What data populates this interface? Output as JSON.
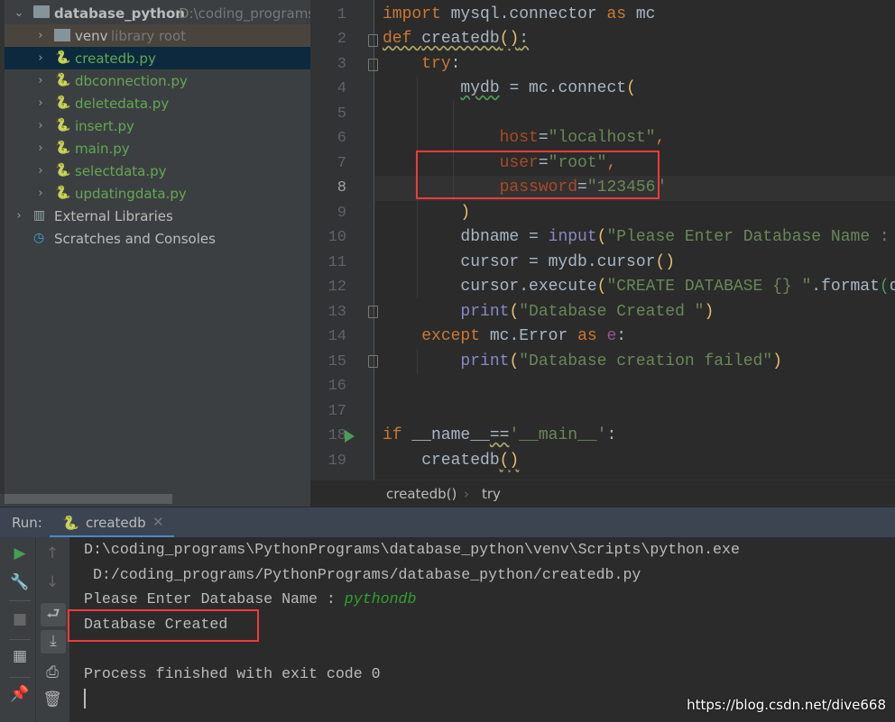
{
  "project": {
    "root": {
      "name": "database_python",
      "path": "D:\\coding_programs"
    },
    "venv": {
      "name": "venv",
      "note": "library root"
    },
    "files": [
      "createdb.py",
      "dbconnection.py",
      "deletedata.py",
      "insert.py",
      "main.py",
      "selectdata.py",
      "updatingdata.py"
    ],
    "selected_file": "createdb.py",
    "external_libraries": "External Libraries",
    "scratches": "Scratches and Consoles"
  },
  "editor": {
    "current_line": 8,
    "lines": [
      [
        [
          "k",
          "import "
        ],
        [
          "",
          "mysql.connector "
        ],
        [
          "k",
          "as "
        ],
        [
          "",
          "mc"
        ]
      ],
      [
        [
          "kw",
          "def "
        ],
        [
          "fw",
          "createdb"
        ],
        [
          "brw",
          "()"
        ],
        [
          "w",
          ":"
        ]
      ],
      [
        [
          "",
          "    "
        ],
        [
          "k",
          "try"
        ],
        [
          "",
          ":"
        ]
      ],
      [
        [
          "",
          "        "
        ],
        [
          "vw",
          "mydb"
        ],
        [
          "",
          " = mc.connect"
        ],
        [
          "br",
          "("
        ]
      ],
      [],
      [
        [
          "",
          "            "
        ],
        [
          "p",
          "host"
        ],
        [
          "",
          "="
        ],
        [
          "s",
          "\"localhost\""
        ],
        [
          "k",
          ","
        ]
      ],
      [
        [
          "",
          "            "
        ],
        [
          "p",
          "user"
        ],
        [
          "",
          "="
        ],
        [
          "s",
          "\"root\""
        ],
        [
          "k",
          ","
        ]
      ],
      [
        [
          "",
          "            "
        ],
        [
          "p",
          "password"
        ],
        [
          "",
          "="
        ],
        [
          "s",
          "\"123456\""
        ]
      ],
      [
        [
          "",
          "        "
        ],
        [
          "br",
          ")"
        ]
      ],
      [
        [
          "",
          "        dbname = "
        ],
        [
          "b",
          "input"
        ],
        [
          "br",
          "("
        ],
        [
          "s",
          "\"Please Enter Database Name : \""
        ],
        [
          "br",
          ")"
        ]
      ],
      [
        [
          "",
          "        cursor = mydb.cursor"
        ],
        [
          "br",
          "()"
        ]
      ],
      [
        [
          "",
          "        cursor.execute"
        ],
        [
          "br",
          "("
        ],
        [
          "s",
          "\"CREATE DATABASE {} \""
        ],
        [
          "",
          ".format"
        ],
        [
          "g",
          "("
        ],
        [
          "",
          "dbname"
        ]
      ],
      [
        [
          "",
          "        "
        ],
        [
          "b",
          "print"
        ],
        [
          "br",
          "("
        ],
        [
          "s",
          "\"Database Created \""
        ],
        [
          "br",
          ")"
        ]
      ],
      [
        [
          "",
          "    "
        ],
        [
          "k",
          "except "
        ],
        [
          "",
          "mc.Error "
        ],
        [
          "k",
          "as "
        ],
        [
          "e",
          "e"
        ],
        [
          "",
          ":"
        ]
      ],
      [
        [
          "",
          "        "
        ],
        [
          "b",
          "print"
        ],
        [
          "br",
          "("
        ],
        [
          "s",
          "\"Database creation failed\""
        ],
        [
          "br",
          ")"
        ]
      ],
      [],
      [],
      [
        [
          "k",
          "if "
        ],
        [
          "",
          "__name__"
        ],
        [
          "w",
          "=="
        ],
        [
          "s",
          "'__main__'"
        ],
        [
          "",
          ":"
        ]
      ],
      [
        [
          "",
          "    createdb"
        ],
        [
          "brw",
          "()"
        ]
      ]
    ]
  },
  "breadcrumb": [
    "createdb()",
    "try"
  ],
  "run": {
    "label": "Run:",
    "tab": "createdb",
    "console": {
      "line1": "D:\\coding_programs\\PythonPrograms\\database_python\\venv\\Scripts\\python.exe",
      "line2": " D:/coding_programs/PythonPrograms/database_python/createdb.py",
      "prompt": "Please Enter Database Name : ",
      "input": "pythondb",
      "line4": "Database Created",
      "line6": "Process finished with exit code 0"
    }
  },
  "watermark": "https://blog.csdn.net/dive668",
  "colors": {
    "keyword": "#cc7832",
    "string": "#6a8759",
    "param": "#aa4926",
    "builtin": "#8888c6",
    "selection": "#0d293e",
    "highlight_box": "#f23a3a",
    "run_green": "#499c54"
  }
}
